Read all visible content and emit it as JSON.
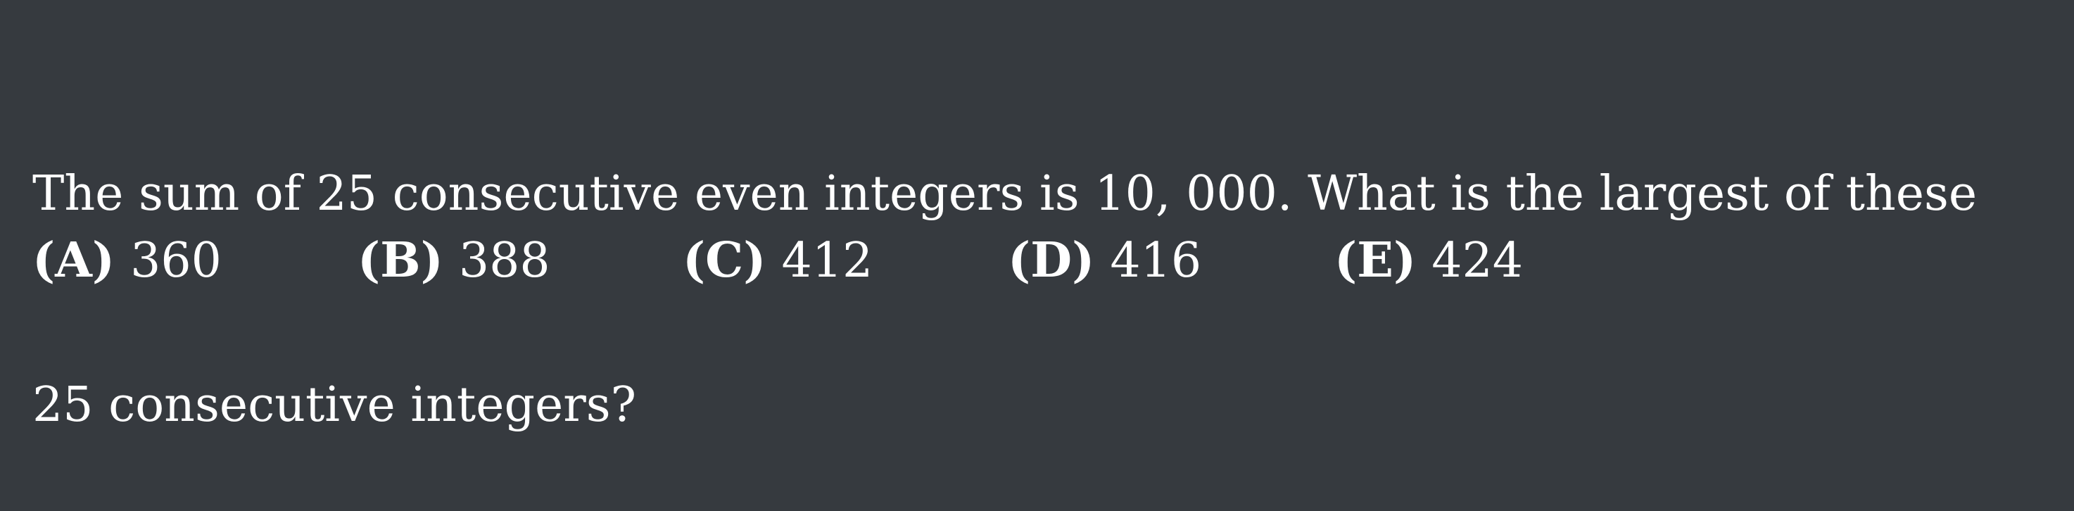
{
  "problem": {
    "line1": "The sum of 25 consecutive even integers is 10, 000. What is the largest of these",
    "line2": "25 consecutive integers?"
  },
  "choices": [
    {
      "letter": "(A)",
      "value": "360"
    },
    {
      "letter": "(B)",
      "value": "388"
    },
    {
      "letter": "(C)",
      "value": "412"
    },
    {
      "letter": "(D)",
      "value": "416"
    },
    {
      "letter": "(E)",
      "value": "424"
    }
  ]
}
